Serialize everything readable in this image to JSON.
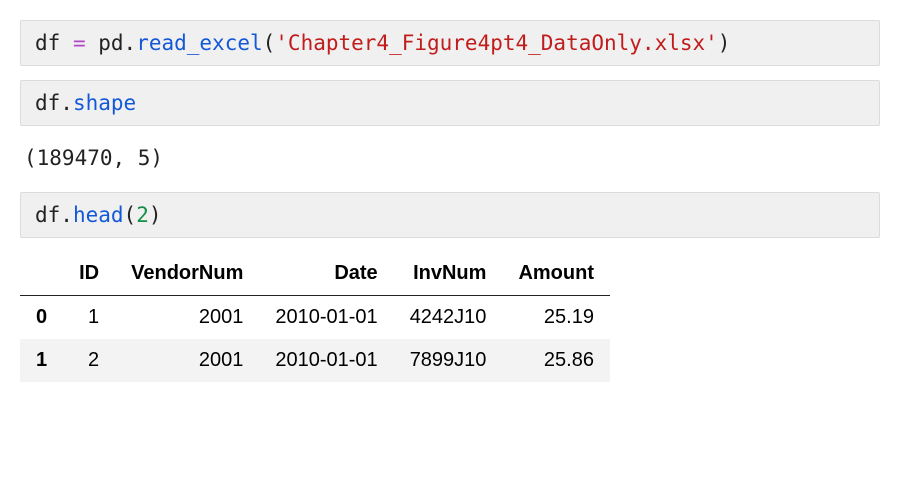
{
  "cell1": {
    "var": "df ",
    "op_eq": "=",
    "mod": " pd",
    "dot1": ".",
    "func": "read_excel",
    "lparen": "(",
    "str": "'Chapter4_Figure4pt4_DataOnly.xlsx'",
    "rparen": ")"
  },
  "cell2": {
    "obj": "df",
    "dot": ".",
    "attr": "shape"
  },
  "output1": "(189470, 5)",
  "cell3": {
    "obj": "df",
    "dot": ".",
    "func": "head",
    "lparen": "(",
    "arg": "2",
    "rparen": ")"
  },
  "table": {
    "columns": [
      "ID",
      "VendorNum",
      "Date",
      "InvNum",
      "Amount"
    ],
    "index": [
      "0",
      "1"
    ],
    "rows": [
      [
        "1",
        "2001",
        "2010-01-01",
        "4242J10",
        "25.19"
      ],
      [
        "2",
        "2001",
        "2010-01-01",
        "7899J10",
        "25.86"
      ]
    ]
  },
  "chart_data": {
    "type": "table",
    "title": "df.head(2)",
    "columns": [
      "ID",
      "VendorNum",
      "Date",
      "InvNum",
      "Amount"
    ],
    "index": [
      0,
      1
    ],
    "rows": [
      {
        "ID": 1,
        "VendorNum": 2001,
        "Date": "2010-01-01",
        "InvNum": "4242J10",
        "Amount": 25.19
      },
      {
        "ID": 2,
        "VendorNum": 2001,
        "Date": "2010-01-01",
        "InvNum": "7899J10",
        "Amount": 25.86
      }
    ]
  }
}
